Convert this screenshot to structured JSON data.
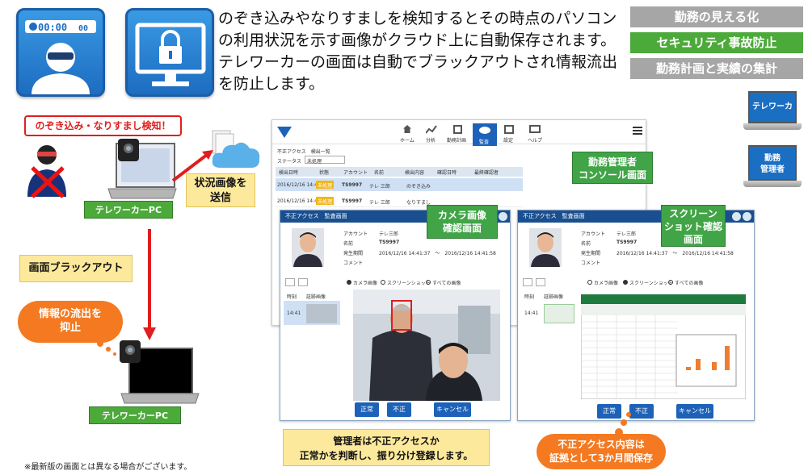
{
  "headline": "のぞき込みやなりすましを検知するとその時点のパソコンの利用状況を示す画像がクラウド上に自動保存されます。テレワーカーの画面は自動でブラックアウトされ情報流出を防止します。",
  "timer_icon": {
    "display": "00:00",
    "seconds": "00"
  },
  "tabs": [
    {
      "label": "勤務の見える化",
      "color": "#a6a6a6"
    },
    {
      "label": "セキュリティ事故防止",
      "color": "#4caa3a"
    },
    {
      "label": "勤務計画と実績の集計",
      "color": "#a6a6a6"
    }
  ],
  "right_laptops": {
    "telework": "テレワーカー",
    "manager": "勤務\n管理者"
  },
  "detect_alert": "のぞき込み・なりすまし検知！",
  "pc_label_top": "テレワーカーPC",
  "pc_label_bottom": "テレワーカーPC",
  "send_box": "状況画像を\n送信",
  "blackout_box": "画面ブラックアウト",
  "leak_bubble": "情報の流出を\n抑止",
  "console_label": "勤務管理者\nコンソール画面",
  "camera_label": "カメラ画像\n確認画面",
  "screenshot_label": "スクリーン\nショット確認\n画面",
  "admin_box": "管理者は不正アクセスか\n正常かを判断し、振り分け登録します。",
  "evidence_bubble": "不正アクセス内容は\n証拠として3か月間保存",
  "footnote": "※最新版の画面とは異なる場合がございます。",
  "console": {
    "nav": [
      "ホーム",
      "分析",
      "勤務計画",
      "監査",
      "設定",
      "ヘルプ"
    ],
    "breadcrumb": "不正アクセス　検出一覧",
    "filter_label": "ステータス",
    "filter_value": "未処理",
    "columns": [
      "検出日時",
      "状態",
      "アカウント",
      "名前",
      "検出内容",
      "確認日時",
      "最終確認者"
    ],
    "rows": [
      {
        "time": "2016/12/16 14:41:37",
        "status": "未処理",
        "id": "TS9997",
        "name": "テレ 三郎",
        "kind": "のぞき込み"
      },
      {
        "time": "2016/12/16 14:40:26",
        "status": "未処理",
        "id": "TS9997",
        "name": "テレ 三郎",
        "kind": "なりすまし"
      }
    ]
  },
  "dialog": {
    "title": "不正アクセス　監査画面",
    "account_label": "アカウント",
    "account_value": "テレ三郎",
    "name_label": "名前",
    "name_value": "TS9997",
    "time_label": "発生期間",
    "time_value": "2016/12/16 14:41:37　〜　2016/12/16 14:41:58",
    "comment_label": "コメント",
    "radio": [
      "カメラ画像",
      "スクリーンショット",
      "すべての画像"
    ],
    "col_time": "時刻",
    "col_evidence": "証跡画像",
    "row_time": "14:41",
    "btn_ok": "正常",
    "btn_ng": "不正",
    "btn_cancel": "キャンセル"
  }
}
